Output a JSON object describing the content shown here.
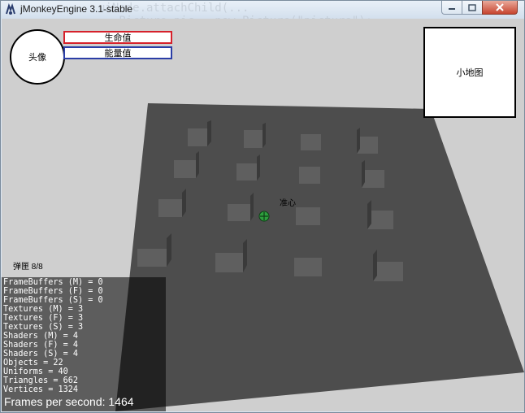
{
  "window": {
    "title": "jMonkeyEngine 3.1-stable",
    "background_code": "uiNode.attachChild(...\n   Picture pic = new Picture(\"picture\");"
  },
  "hud": {
    "avatar": "头像",
    "health": "生命值",
    "energy": "能量值",
    "minimap": "小地图",
    "crosshair": "准心",
    "ammo": "弹匣 8/8"
  },
  "stats": [
    "FrameBuffers (M) = 0",
    "FrameBuffers (F) = 0",
    "FrameBuffers (S) = 0",
    "Textures (M) = 3",
    "Textures (F) = 3",
    "Textures (S) = 3",
    "Shaders (M) = 4",
    "Shaders (F) = 4",
    "Shaders (S) = 4",
    "Objects = 22",
    "Uniforms = 40",
    "Triangles = 662",
    "Vertices = 1324"
  ],
  "fps_text": "Frames per second: 1464",
  "colors": {
    "floor": "#4d4d4d",
    "sky": "#cfcfcf",
    "health_border": "#d6212b",
    "energy_border": "#2b3ea6",
    "crosshair": "#2e9e3e"
  },
  "icons": [
    "app-icon",
    "minimize-icon",
    "maximize-icon",
    "close-icon",
    "crosshair-icon"
  ]
}
